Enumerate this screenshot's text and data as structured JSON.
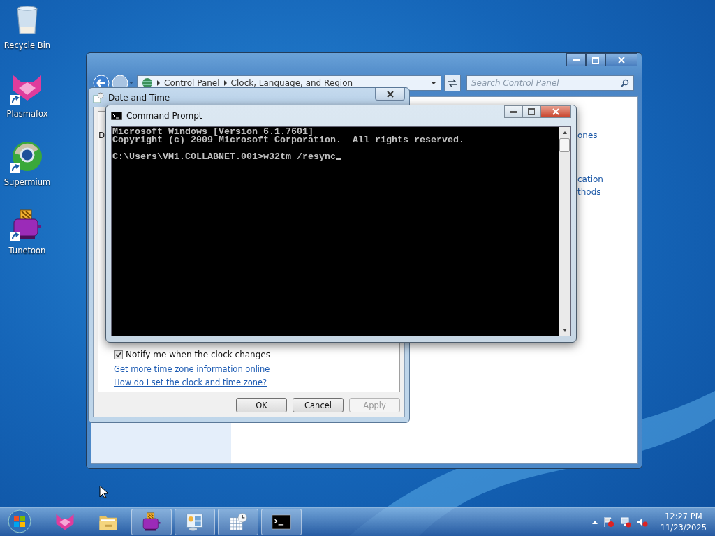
{
  "desktop_icons": [
    {
      "kind": "recycle-bin",
      "label": "Recycle Bin",
      "shortcut": false
    },
    {
      "kind": "fox",
      "label": "Plasmafox",
      "shortcut": true
    },
    {
      "kind": "globe",
      "label": "Supermium",
      "shortcut": true
    },
    {
      "kind": "toaster",
      "label": "Tunetoon",
      "shortcut": true
    }
  ],
  "control_panel": {
    "breadcrumb": [
      "Control Panel",
      "Clock, Language, and Region"
    ],
    "search": {
      "placeholder": "Search Control Panel"
    },
    "link_fragments": [
      "ones",
      "cation",
      "thods"
    ]
  },
  "date_time_dialog": {
    "title": "Date and Time",
    "tab_fragment": "D",
    "notify": {
      "label": "Notify me when the clock changes",
      "checked": true
    },
    "links": [
      "Get more time zone information online",
      "How do I set the clock and time zone?"
    ],
    "buttons": [
      {
        "label": "OK",
        "disabled": false
      },
      {
        "label": "Cancel",
        "disabled": false
      },
      {
        "label": "Apply",
        "disabled": true
      }
    ]
  },
  "command_prompt": {
    "title": "Command Prompt",
    "blocks": [
      [
        "Microsoft Windows [Version 6.1.7601]",
        "Copyright (c) 2009 Microsoft Corporation.  All rights reserved."
      ],
      [
        "C:\\Users\\VM1.COLLABNET.001>w32tm /resync"
      ]
    ]
  },
  "taskbar": {
    "items": [
      {
        "kind": "fox",
        "running": false
      },
      {
        "kind": "folder",
        "running": false
      },
      {
        "kind": "toaster",
        "running": true
      },
      {
        "kind": "control-panel",
        "running": true
      },
      {
        "kind": "calendar-clock",
        "running": true
      },
      {
        "kind": "console",
        "running": true
      }
    ],
    "clock": {
      "time": "12:27 PM",
      "date": "11/23/2025"
    }
  }
}
